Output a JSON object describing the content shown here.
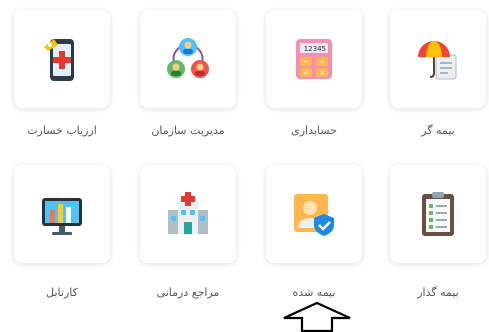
{
  "tiles": [
    {
      "label": "ارزیاب خسارت",
      "icon": "damage-assessor-tablet-icon"
    },
    {
      "label": "مدیریت سازمان",
      "icon": "organization-people-icon"
    },
    {
      "label": "حسابداری",
      "icon": "calculator-icon"
    },
    {
      "label": "بیمه گر",
      "icon": "insurer-umbrella-document-icon"
    },
    {
      "label": "کارتابل",
      "icon": "cartable-monitor-chart-icon"
    },
    {
      "label": "مراجع درمانی",
      "icon": "hospital-icon"
    },
    {
      "label": "بیمه شده",
      "icon": "insured-person-shield-icon"
    },
    {
      "label": "بیمه گذار",
      "icon": "policyholder-clipboard-icon"
    }
  ],
  "calculator_display": "12345",
  "colors": {
    "card_bg": "#ffffff",
    "label": "#555555",
    "shadow": "rgba(0,0,0,0.14)"
  }
}
